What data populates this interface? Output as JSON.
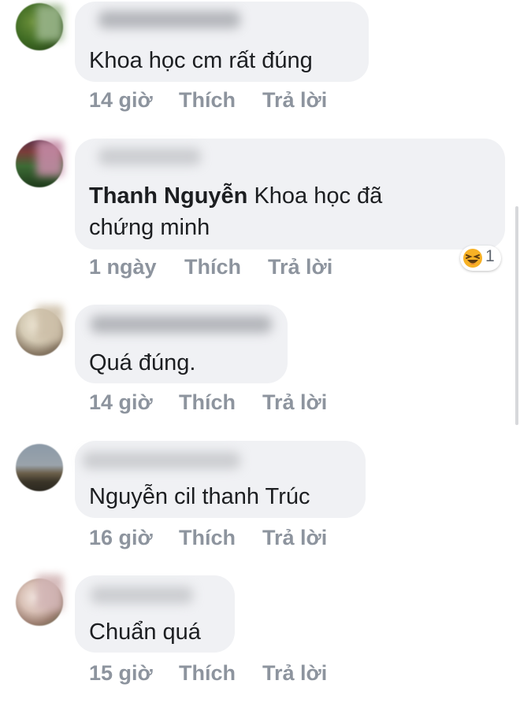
{
  "comments": [
    {
      "text": "Khoa học cm rất đúng",
      "time": "14 giờ",
      "like": "Thích",
      "reply": "Trả lời"
    },
    {
      "tag": "Thanh Nguyễn",
      "text": " Khoa học đã",
      "text2": "chứng minh",
      "time": "1 ngày",
      "like": "Thích",
      "reply": "Trả lời",
      "reaction": {
        "icon": "laughing-emoji-icon",
        "count": "1"
      }
    },
    {
      "text": "Quá đúng.",
      "time": "14 giờ",
      "like": "Thích",
      "reply": "Trả lời"
    },
    {
      "text": "Nguyễn cil thanh Trúc",
      "time": "16 giờ",
      "like": "Thích",
      "reply": "Trả lời"
    },
    {
      "text": "Chuẩn quá",
      "time": "15 giờ",
      "like": "Thích",
      "reply": "Trả lời"
    }
  ],
  "colors": {
    "bubble": "#f0f1f4",
    "text": "#1c1e21",
    "meta": "#8d949e",
    "reaction": "#f7b125"
  }
}
